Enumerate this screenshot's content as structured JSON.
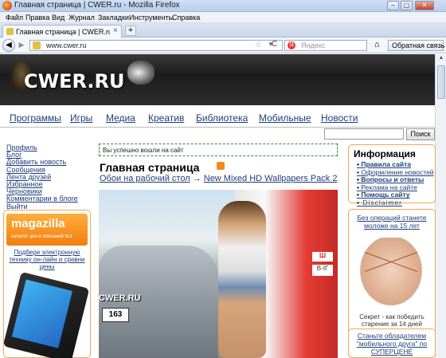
{
  "window": {
    "title": "Главная страница | CWER.ru - Mozilla Firefox",
    "controls": {
      "minimize": "–",
      "maximize": "▢",
      "close": "✕"
    }
  },
  "menu": [
    "Файл",
    "Правка",
    "Вид",
    "Журнал",
    "Закладки",
    "Инструменты",
    "Справка"
  ],
  "tab": {
    "label": "Главная страница | CWER.ru",
    "close": "×",
    "new": "+"
  },
  "nav": {
    "back": "◀",
    "forward": "▶",
    "url": "www.cwer.ru",
    "star": "☆",
    "dropdown": "▼",
    "reload": "C",
    "search_placeholder": "Яндекс",
    "search_engine_letter": "Я",
    "home": "⌂",
    "feedback": "Обратная связь ▾"
  },
  "site": {
    "logo": "CWER.RU",
    "main_nav": [
      "Программы",
      "Игры",
      "Медиа",
      "Креатив",
      "Библиотека",
      "Мобильные",
      "Новости"
    ],
    "search_button": "Поиск",
    "search_value": "",
    "left_menu": [
      "Профиль",
      "Блог",
      "Добавить новость",
      "Сообщения",
      "Лента друзей",
      "Избранное",
      "Черновики",
      "Комментарии в блоге",
      "Выйти"
    ],
    "notice": "Вы успешно вошли на сайт",
    "page_title": "Главная страница",
    "breadcrumb": {
      "first": "Обои на рабочий стол",
      "sep": "→",
      "second": "New Mixed HD Wallpapers Pack 2"
    },
    "photo": {
      "watermark": "CWER.RU",
      "plate": "163",
      "sign_top": "Ш",
      "sign_bottom": "В-ІГ"
    },
    "left_ad": {
      "brand": "magazilla",
      "slogan": "каталог цен и описаний №1",
      "link": "Подбери электронную технику он-лайн и сравни цены"
    },
    "info": {
      "heading": "Информация",
      "items": [
        {
          "label": "Правила сайта",
          "bold": true
        },
        {
          "label": "Оформление новостей",
          "bold": false
        },
        {
          "label": "Вопросы и ответы",
          "bold": true
        },
        {
          "label": "Реклама на сайте",
          "bold": false
        },
        {
          "label": "Помощь сайту",
          "bold": true
        },
        {
          "label": "Disclaimer",
          "bold": false
        }
      ]
    },
    "right_ad": {
      "title": "Без операций станете моложе на 15 лет",
      "caption": "Секрет - как победить старение за 14 дней"
    },
    "right_ad2": {
      "title": "Станьте обладателем \"мобильного друга\" по СУПЕРЦЕНЕ"
    }
  },
  "colors": {
    "link": "#1e3d7a",
    "accent_orange": "#f2a65a",
    "header_bg": "#2a2a2a"
  }
}
